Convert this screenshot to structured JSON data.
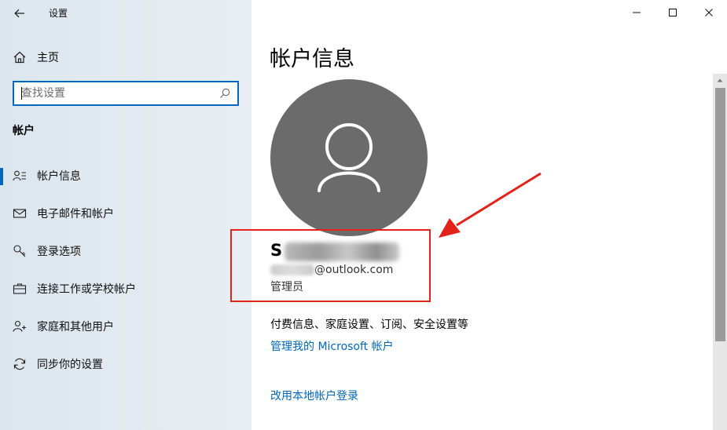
{
  "window": {
    "title": "设置",
    "back_icon": "back-arrow-icon",
    "controls": [
      "minimize-icon",
      "maximize-icon",
      "close-icon"
    ]
  },
  "sidebar": {
    "home_label": "主页",
    "search_placeholder": "查找设置",
    "section_header": "帐户",
    "items": [
      {
        "label": "帐户信息",
        "icon": "person-info-icon",
        "active": true
      },
      {
        "label": "电子邮件和帐户",
        "icon": "mail-icon",
        "active": false
      },
      {
        "label": "登录选项",
        "icon": "key-icon",
        "active": false
      },
      {
        "label": "连接工作或学校帐户",
        "icon": "briefcase-icon",
        "active": false
      },
      {
        "label": "家庭和其他用户",
        "icon": "add-person-icon",
        "active": false
      },
      {
        "label": "同步你的设置",
        "icon": "sync-icon",
        "active": false
      }
    ]
  },
  "main": {
    "title": "帐户信息",
    "user_name_visible": "S",
    "email_visible": "@outlook.com",
    "role": "管理员",
    "billing_text": "付费信息、家庭设置、订阅、安全设置等",
    "manage_link": "管理我的 Microsoft 帐户",
    "local_link": "改用本地帐户登录"
  },
  "colors": {
    "accent": "#0067c0",
    "link": "#0067b8",
    "annotation_red": "#e2231a",
    "avatar_bg": "#6b6b6b"
  }
}
